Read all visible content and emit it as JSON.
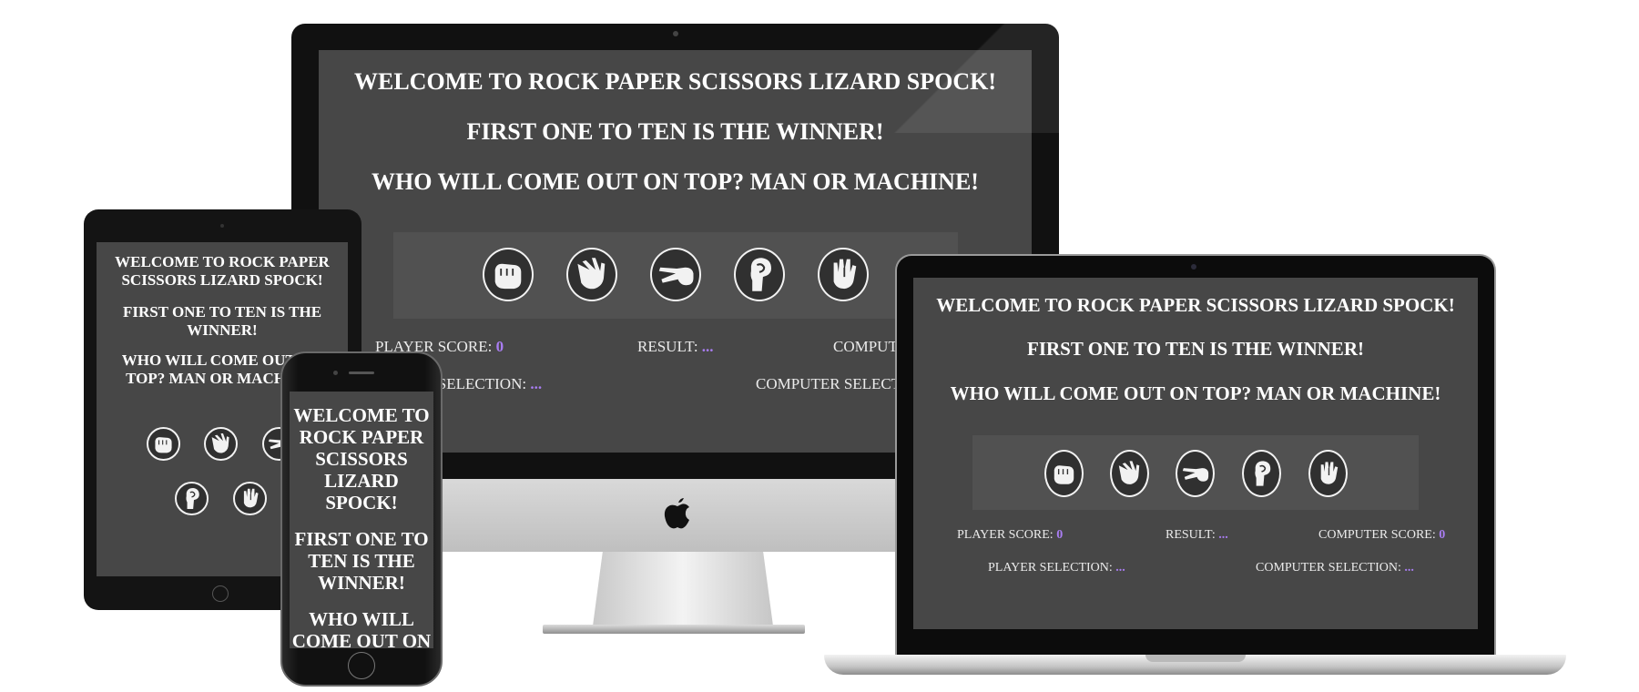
{
  "game": {
    "welcome": "WELCOME TO ROCK PAPER SCISSORS LIZARD SPOCK!",
    "welcome_lines_tablet": [
      "WELCOME TO ROCK PAPER",
      "SCISSORS LIZARD SPOCK!"
    ],
    "welcome_lines_phone": [
      "WELCOME TO",
      "ROCK PAPER",
      "SCISSORS",
      "LIZARD",
      "SPOCK!"
    ],
    "first_to": "FIRST ONE TO TEN IS THE WINNER!",
    "first_to_lines_tablet": [
      "FIRST ONE TO TEN IS THE",
      "WINNER!"
    ],
    "first_to_lines_phone": [
      "FIRST ONE TO",
      "TEN IS THE",
      "WINNER!"
    ],
    "who_wins": "WHO WILL COME OUT ON TOP? MAN OR MACHINE!",
    "who_wins_lines_tablet": [
      "WHO WILL COME OUT ON",
      "TOP? MAN OR MACHINE!"
    ],
    "who_wins_lines_phone": [
      "WHO WILL",
      "COME OUT ON"
    ],
    "choices": [
      "rock",
      "paper",
      "scissors",
      "lizard",
      "spock"
    ],
    "player_score_label": "PLAYER SCORE:",
    "player_score": "0",
    "result_label": "RESULT:",
    "result": "...",
    "computer_score_label": "COMPUTER SCORE:",
    "computer_score": "0",
    "player_selection_label": "PLAYER SELECTION:",
    "player_selection": "...",
    "computer_selection_label": "COMPUTER SELECTION:",
    "computer_selection": "..."
  },
  "colors": {
    "screen": "#474747",
    "panel": "#515151",
    "accent": "#a97df2"
  }
}
